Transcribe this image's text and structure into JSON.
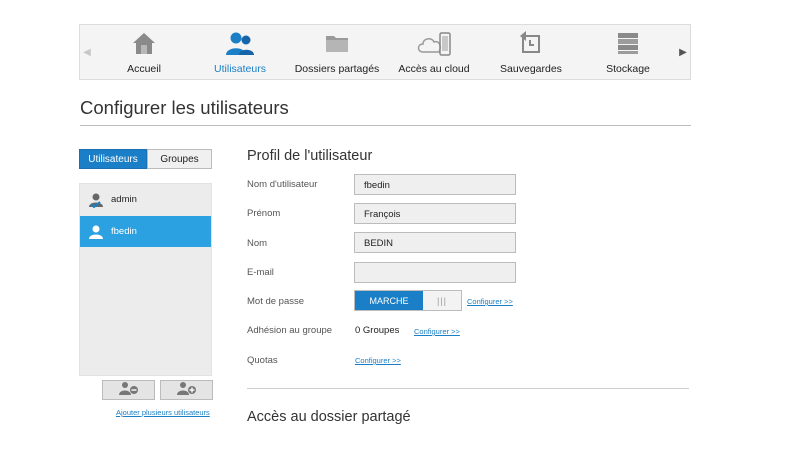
{
  "nav": {
    "items": [
      {
        "label": "Accueil",
        "icon": "home-icon"
      },
      {
        "label": "Utilisateurs",
        "icon": "users-icon"
      },
      {
        "label": "Dossiers partagés",
        "icon": "folder-icon"
      },
      {
        "label": "Accès au cloud",
        "icon": "cloud-device-icon"
      },
      {
        "label": "Sauvegardes",
        "icon": "backup-icon"
      },
      {
        "label": "Stockage",
        "icon": "storage-icon"
      }
    ],
    "active_index": 1
  },
  "page": {
    "title": "Configurer les utilisateurs"
  },
  "tabs": {
    "users": "Utilisateurs",
    "groups": "Groupes"
  },
  "users": {
    "items": [
      {
        "name": "admin",
        "icon": "admin-user-icon"
      },
      {
        "name": "fbedin",
        "icon": "user-icon"
      }
    ],
    "selected_index": 1,
    "add_multiple_label": "Ajouter plusieurs utilisateurs"
  },
  "profile": {
    "title": "Profil de l'utilisateur",
    "labels": {
      "username": "Nom d'utilisateur",
      "firstname": "Prénom",
      "lastname": "Nom",
      "email": "E-mail",
      "password": "Mot de passe",
      "group_membership": "Adhésion au groupe",
      "quotas": "Quotas"
    },
    "values": {
      "username": "fbedin",
      "firstname": "François",
      "lastname": "BEDIN",
      "email": ""
    },
    "password_toggle": {
      "on_label": "MARCHE",
      "handle": "|||"
    },
    "configure_label": "Configurer >>",
    "group_count": "0 Groupes"
  },
  "shared_access": {
    "title": "Accès au dossier partagé"
  },
  "colors": {
    "accent": "#1a7fc6",
    "selected_row": "#2ca1e2"
  }
}
